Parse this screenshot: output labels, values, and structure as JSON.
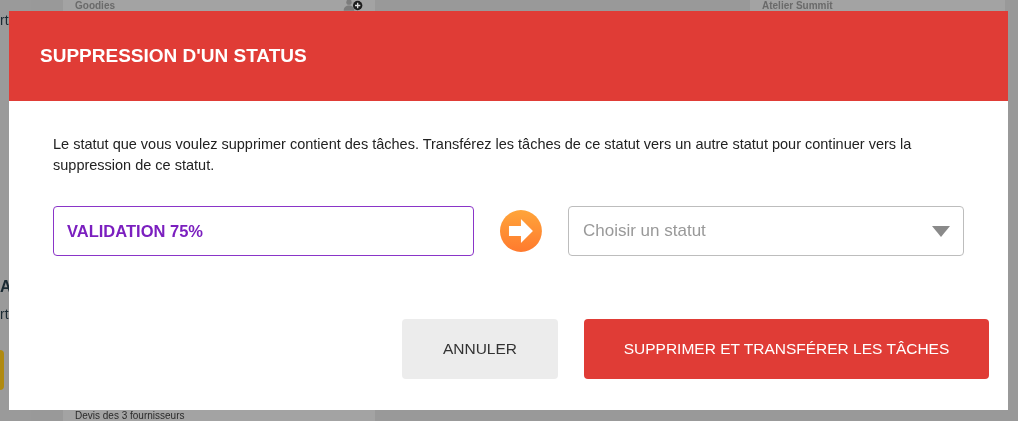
{
  "background": {
    "left_edge_texts": [
      "rt",
      "A",
      "rt"
    ],
    "cards": [
      {
        "title": "Goodies"
      },
      {
        "title": "Atelier Summit"
      },
      {
        "title": "Devis des 3 fournisseurs"
      }
    ]
  },
  "dialog": {
    "title": "SUPPRESSION D'UN STATUS",
    "message": "Le statut que vous voulez supprimer contient des tâches. Transférez les tâches de ce statut vers un autre statut pour continuer vers la suppression de ce statut.",
    "source_status": {
      "value": "VALIDATION 75%"
    },
    "target_status": {
      "placeholder": "Choisir un statut"
    },
    "buttons": [
      {
        "label": "ANNULER",
        "kind": "secondary"
      },
      {
        "label": "SUPPRIMER ET TRANSFÉRER LES TÂCHES",
        "kind": "primary"
      }
    ]
  }
}
